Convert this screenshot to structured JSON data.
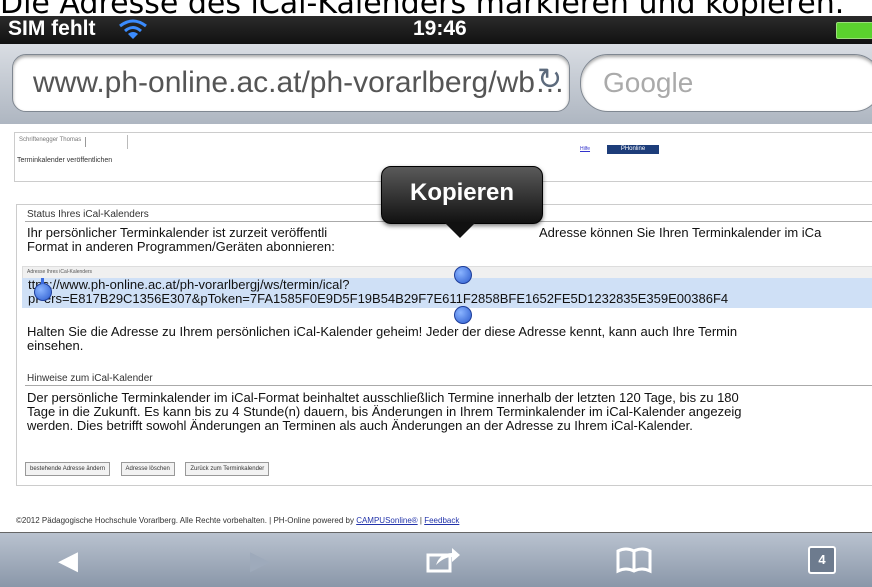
{
  "caption": "Die Adresse des iCal-Kalenders markieren und kopieren.",
  "status_bar": {
    "carrier": "SIM fehlt",
    "time": "19:46"
  },
  "browser": {
    "url": "www.ph-online.ac.at/ph-vorarlberg/wb…",
    "search_placeholder": "Google"
  },
  "page": {
    "user_name": "Schriftenegger Thomas",
    "title": "Terminkalender veröffentlichen",
    "help_link": "Hilfe",
    "logo_text": "PHonline",
    "status_section": {
      "header": "Status Ihres iCal-Kalenders",
      "text_line1": "Ihr persönlicher Terminkalender ist zurzeit veröffentli",
      "text_line1b": "Adresse können Sie Ihren Terminkalender im iCa",
      "text_line2": "Format in anderen Programmen/Geräten abonnieren:",
      "address_label": "Adresse Ihres iCal-Kalenders",
      "address_line1": "ttps://www.ph-online.ac.at/ph-vorarlbergj/ws/termin/ical?",
      "address_line2": "pPers=E817B29C1356E307&pToken=7FA1585F0E9D5F19B54B29F7E611F2858BFE1652FE5D1232835E359E00386F4",
      "warning_line1": "Halten Sie die Adresse zu Ihrem persönlichen iCal-Kalender geheim! Jeder der diese Adresse kennt, kann auch Ihre Termin",
      "warning_line2": "einsehen."
    },
    "hints_section": {
      "header": "Hinweise zum iCal-Kalender",
      "line1": "Der persönliche Terminkalender im iCal-Format beinhaltet ausschließlich Termine innerhalb der letzten 120 Tage, bis zu 180",
      "line2": "Tage in die Zukunft. Es kann bis zu 4 Stunde(n) dauern, bis Änderungen in Ihrem Terminkalender im iCal-Kalender angezeig",
      "line3": "werden. Dies betrifft sowohl Änderungen an Terminen als auch Änderungen an der Adresse zu Ihrem iCal-Kalender."
    },
    "buttons": {
      "change_address": "bestehende Adresse ändern",
      "delete_address": "Adresse löschen",
      "back": "Zurück zum Terminkalender"
    },
    "footer": {
      "text": "©2012 Pädagogische Hochschule Vorarlberg. Alle Rechte vorbehalten. | PH-Online powered by ",
      "campus_link": "CAMPUSonline®",
      "separator": " | ",
      "feedback_link": "Feedback"
    }
  },
  "context_menu": {
    "copy_label": "Kopieren"
  },
  "toolbar": {
    "tabs_count": "4"
  }
}
